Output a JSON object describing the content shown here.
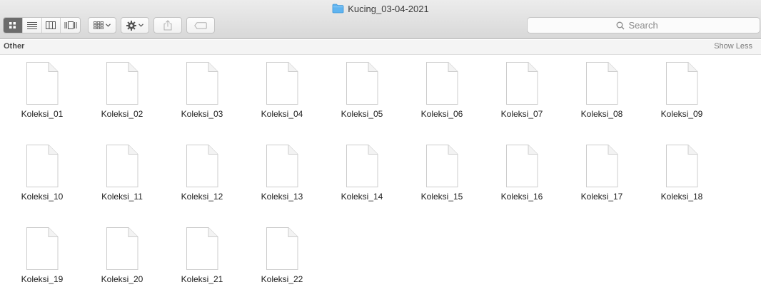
{
  "window": {
    "title": "Kucing_03-04-2021",
    "title_icon": "folder-icon"
  },
  "toolbar": {
    "view_modes": [
      {
        "name": "icon-view",
        "icon": "grid-icon",
        "active": true
      },
      {
        "name": "list-view",
        "icon": "list-icon",
        "active": false
      },
      {
        "name": "column-view",
        "icon": "columns-icon",
        "active": false
      },
      {
        "name": "gallery-view",
        "icon": "gallery-icon",
        "active": false
      }
    ],
    "arrange": {
      "icon": "arrange-grid-icon"
    },
    "action": {
      "icon": "gear-icon"
    },
    "share": {
      "icon": "share-icon"
    },
    "tags": {
      "icon": "tag-icon"
    }
  },
  "search": {
    "placeholder": "Search",
    "value": ""
  },
  "section": {
    "title": "Other",
    "toggle_label": "Show Less"
  },
  "files": [
    {
      "name": "Koleksi_01"
    },
    {
      "name": "Koleksi_02"
    },
    {
      "name": "Koleksi_03"
    },
    {
      "name": "Koleksi_04"
    },
    {
      "name": "Koleksi_05"
    },
    {
      "name": "Koleksi_06"
    },
    {
      "name": "Koleksi_07"
    },
    {
      "name": "Koleksi_08"
    },
    {
      "name": "Koleksi_09"
    },
    {
      "name": "Koleksi_10"
    },
    {
      "name": "Koleksi_11"
    },
    {
      "name": "Koleksi_12"
    },
    {
      "name": "Koleksi_13"
    },
    {
      "name": "Koleksi_14"
    },
    {
      "name": "Koleksi_15"
    },
    {
      "name": "Koleksi_16"
    },
    {
      "name": "Koleksi_17"
    },
    {
      "name": "Koleksi_18"
    },
    {
      "name": "Koleksi_19"
    },
    {
      "name": "Koleksi_20"
    },
    {
      "name": "Koleksi_21"
    },
    {
      "name": "Koleksi_22"
    }
  ],
  "colors": {
    "active_segment": "#6c6c6c",
    "folder_blue": "#5fb4f0"
  }
}
